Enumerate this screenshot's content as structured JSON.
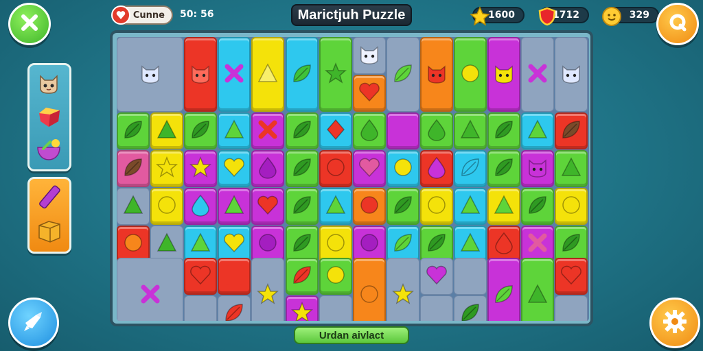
{
  "header": {
    "title": "Marictjuh Puzzle",
    "continue_label": "Cunne",
    "timer": "50: 56",
    "stars_value": "1600",
    "shield_value": "1712",
    "coins_value": "329"
  },
  "footer": {
    "action_label": "Urdan aivlact"
  },
  "colors": {
    "green": "#5ed43a",
    "yellow": "#f4e20a",
    "cyan": "#2ec8ee",
    "magenta": "#c832d8",
    "red": "#ec3526",
    "orange": "#f7861b",
    "pink": "#e25aa0",
    "empty": "#8fa4bf"
  },
  "icons": {
    "close": "close-icon",
    "rocket": "rocket-icon",
    "settings": "gear-icon",
    "help": "help-icon",
    "powerups": [
      "cat-face-icon",
      "gem-icon",
      "bowl-icon",
      "crayon-icon",
      "box-icon"
    ]
  }
}
